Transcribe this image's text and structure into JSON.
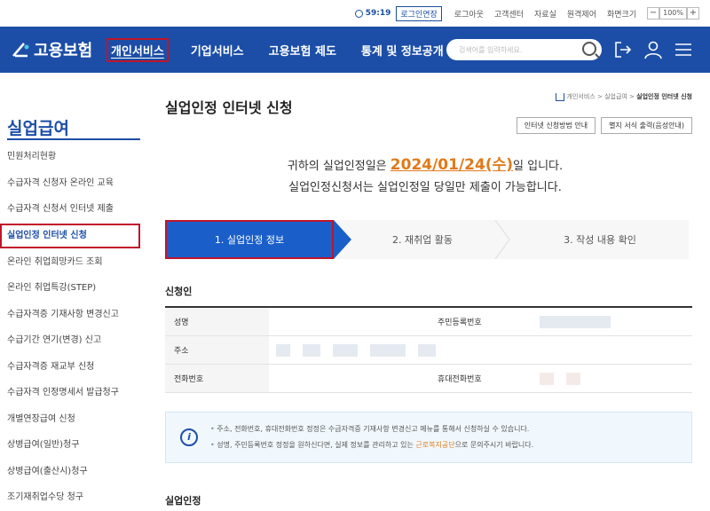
{
  "topbar": {
    "timer": "59:19",
    "extend_label": "로그인연장",
    "util": [
      "로그아웃",
      "고객센터",
      "자료실",
      "원격제어",
      "화면크기"
    ],
    "zoom_minus": "−",
    "zoom_value": "100%",
    "zoom_plus": "+"
  },
  "nav": {
    "logo_text": "고용보험",
    "menu": [
      "개인서비스",
      "기업서비스",
      "고용보험 제도",
      "통계 및 정보공개"
    ],
    "search_placeholder": "검색어를 입력하세요."
  },
  "sidebar": {
    "title": "실업급여",
    "items": [
      "민원처리현황",
      "수급자격 신청자 온라인 교육",
      "수급자격 신청서 인터넷 제출",
      "실업인정 인터넷 신청",
      "온라인 취업희망카드 조회",
      "온라인 취업특강(STEP)",
      "수급자격증 기재사항 변경신고",
      "수급기간 연기(변경) 신고",
      "수급자격증 재교부 신청",
      "수급자격 인정명세서 발급청구",
      "개별연장급여 신청",
      "상병급여(일반)청구",
      "상병급여(출산시)청구",
      "조기재취업수당 청구"
    ],
    "current_index": 3
  },
  "main": {
    "title": "실업인정 인터넷 신청",
    "breadcrumb": [
      "개인서비스",
      "실업급여",
      "실업인정 인터넷 신청"
    ],
    "btn_guide": "인터넷 신청방법 안내",
    "btn_print": "별지 서식 출력(음성안내)",
    "notice_pre": "귀하의 실업인정일은 ",
    "notice_date": "2024/01/24(수)",
    "notice_post": "일 입니다.",
    "notice_line2": "실업인정신청서는 실업인정일 당일만 제출이 가능합니다.",
    "steps": [
      "1. 실업인정 정보",
      "2. 재취업 활동",
      "3. 작성 내용 확인"
    ],
    "applicant_title": "신청인",
    "table": {
      "name": "성명",
      "rrn": "주민등록번호",
      "address": "주소",
      "phone": "전화번호",
      "mobile": "휴대전화번호"
    },
    "info_line1": "주소, 전화번호, 휴대전화번호 정정은 수급자격증 기재사항 변경신고 메뉴를 통해서 신청하실 수 있습니다.",
    "info_line2_pre": "성명, 주민등록번호 정정을 원하신다면, 실제 정보를 관리하고 있는 ",
    "info_line2_hl": "근로복지공단",
    "info_line2_post": "으로 문의주시기 바랍니다.",
    "unemployment_title": "실업인정"
  }
}
